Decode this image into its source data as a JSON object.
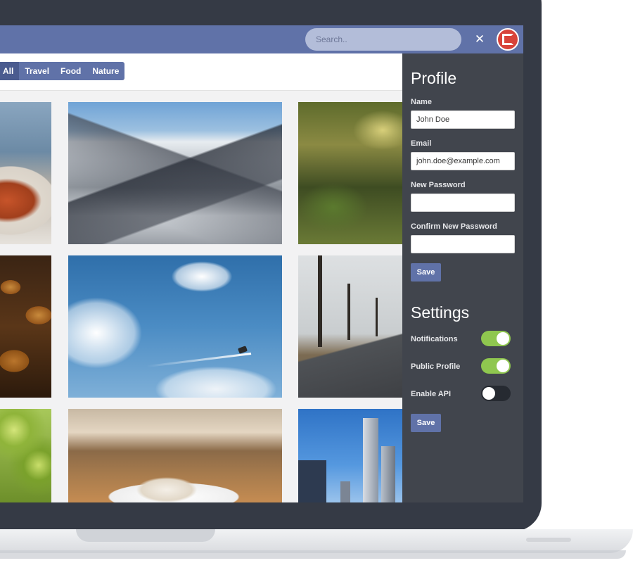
{
  "header": {
    "search_placeholder": "Search..",
    "tools_icon": "tools-icon",
    "avatar_icon": "app-logo-icon"
  },
  "filters": [
    {
      "label": "All",
      "active": true
    },
    {
      "label": "Travel",
      "active": false
    },
    {
      "label": "Food",
      "active": false
    },
    {
      "label": "Nature",
      "active": false
    }
  ],
  "profile": {
    "title": "Profile",
    "name_label": "Name",
    "name_value": "John Doe",
    "email_label": "Email",
    "email_value": "john.doe@example.com",
    "new_password_label": "New Password",
    "new_password_value": "",
    "confirm_password_label": "Confirm New Password",
    "confirm_password_value": "",
    "save_label": "Save"
  },
  "settings": {
    "title": "Settings",
    "toggles": [
      {
        "label": "Notifications",
        "on": true
      },
      {
        "label": "Public Profile",
        "on": true
      },
      {
        "label": "Enable API",
        "on": false
      }
    ],
    "save_label": "Save"
  },
  "colors": {
    "accent": "#6072a8",
    "toggle_on": "#8fc74f",
    "panel_bg": "#34383f",
    "laptop_frame": "#353a45"
  }
}
